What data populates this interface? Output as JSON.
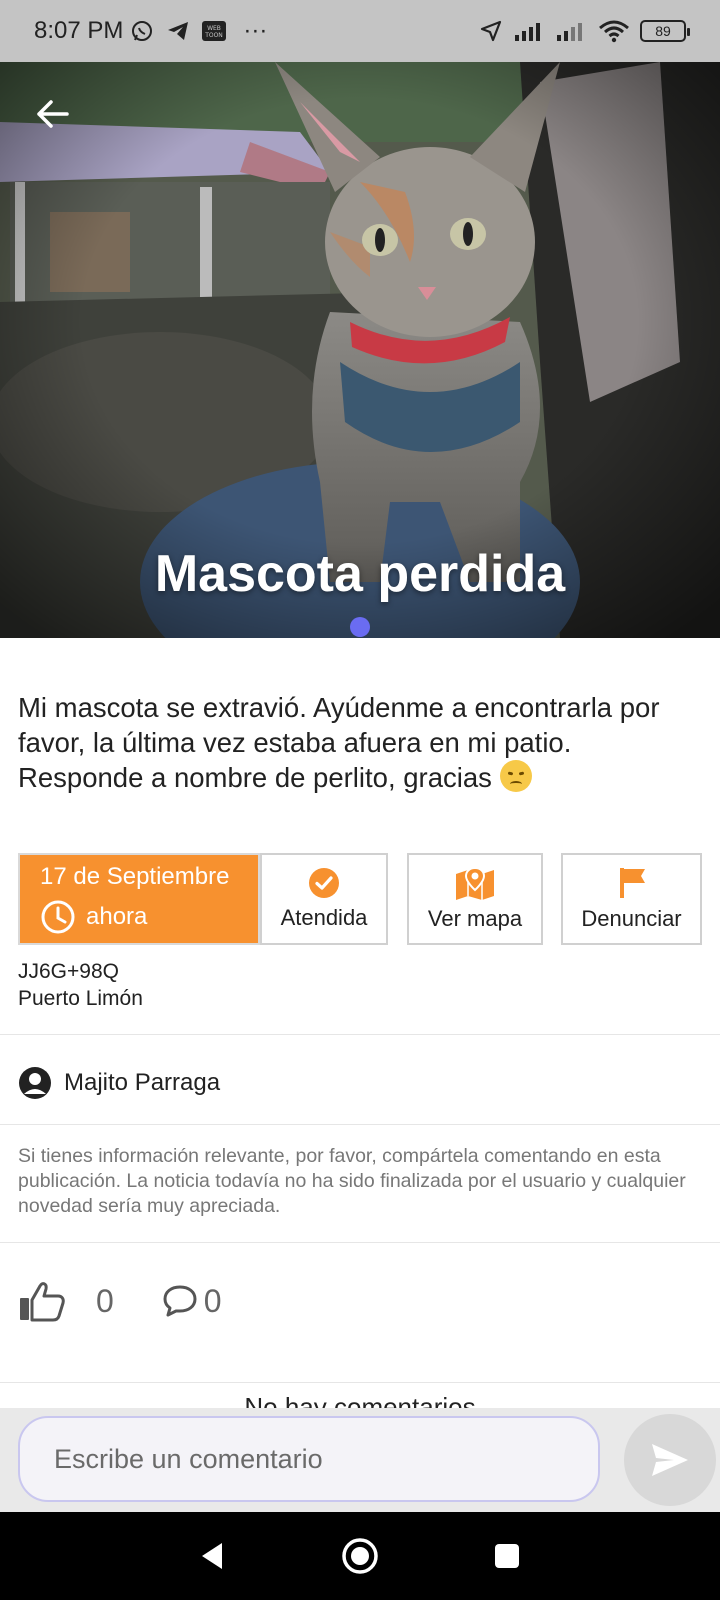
{
  "status_bar": {
    "time": "8:07 PM",
    "battery": "89",
    "left_icons": [
      "whatsapp-icon",
      "telegram-icon",
      "webtoon-icon",
      "more-dots-icon"
    ],
    "right_icons": [
      "location-arrow-icon",
      "signal-icon",
      "signal-icon",
      "wifi-icon",
      "battery-icon"
    ],
    "webtoon_label": "WEB TOON",
    "more_dots": "···"
  },
  "hero": {
    "title": "Mascota perdida",
    "slide_index": 1,
    "slide_count": 1,
    "colors": {
      "pager_dot": "#6a6cf2"
    }
  },
  "post": {
    "description": "Mi mascota se extravió. Ayúdenme a encontrarla por favor, la última vez estaba afuera en mi patio. Responde a nombre de perlito, gracias",
    "emoji": "disappointed-face-emoji"
  },
  "actions": {
    "date": "17 de Septiembre",
    "time_label": "ahora",
    "attended_label": "Atendida",
    "map_label": "Ver mapa",
    "report_label": "Denunciar",
    "accent_color": "#f7912f"
  },
  "location": {
    "plus_code": "JJ6G+98Q",
    "city": "Puerto Limón"
  },
  "author": {
    "name": "Majito Parraga"
  },
  "info": {
    "text": "Si tienes información relevante, por favor, compártela comentando en esta publicación. La noticia todavía no ha sido finalizada por el usuario y cualquier novedad sería muy apreciada."
  },
  "reactions": {
    "likes": "0",
    "comments": "0"
  },
  "comments_section": {
    "empty_label": "No hay comentarios"
  },
  "comment_bar": {
    "placeholder": "Escribe un comentario"
  }
}
